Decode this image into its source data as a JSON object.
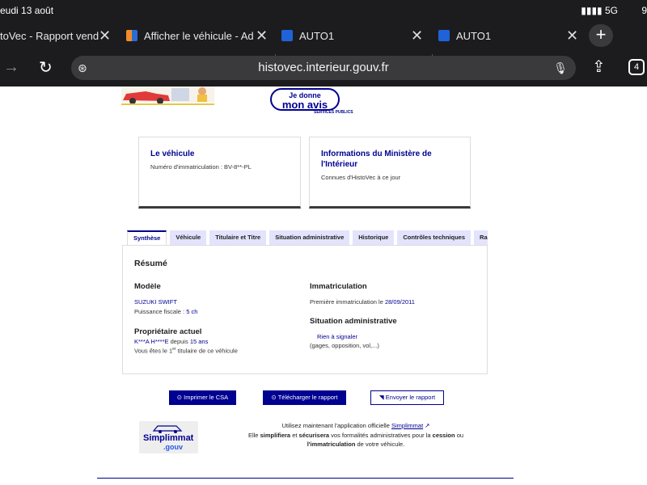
{
  "status_bar": {
    "time": "eudi 13 août",
    "signal": "5G",
    "battery": "9"
  },
  "browser_tabs": [
    {
      "title": "toVec - Rapport vend",
      "active": true
    },
    {
      "title": "Afficher le véhicule - Ad",
      "active": false
    },
    {
      "title": "AUTO1",
      "active": false
    },
    {
      "title": "AUTO1",
      "active": false
    }
  ],
  "toolbar": {
    "url": "histovec.interieur.gouv.fr",
    "tab_count": "4"
  },
  "banner": {
    "avis_line1": "Je donne",
    "avis_line2": "mon avis",
    "services_publics": "SERVICES PUBLICS"
  },
  "cards": {
    "vehicule": {
      "title": "Le véhicule",
      "text": "Numéro d'immatriculation : BV-8**-PL"
    },
    "ministere": {
      "title": "Informations du Ministère de l'Intérieur",
      "text": "Connues d'HistoVec à ce jour"
    }
  },
  "section_tabs": [
    "Synthèse",
    "Véhicule",
    "Titulaire et Titre",
    "Situation administrative",
    "Historique",
    "Contrôles techniques",
    "Rap"
  ],
  "resume": {
    "title": "Résumé",
    "modele_label": "Modèle",
    "modele": "SUZUKI SWIFT",
    "puissance_label": "Puissance fiscale :",
    "puissance": "5 ch",
    "proprietaire_label": "Propriétaire actuel",
    "proprietaire_name": "K***A H****E",
    "depuis_label": "depuis",
    "depuis": "15 ans",
    "titulaire_pre": "Vous êtes le 1",
    "titulaire_sup": "er",
    "titulaire_post": "titulaire de ce véhicule",
    "immat_label": "Immatriculation",
    "premiere_label": "Première immatriculation le",
    "premiere_date": "28/09/2011",
    "situation_label": "Situation administrative",
    "situation_value": "Rien à signaler",
    "situation_note": "(gages, opposition, vol,...)"
  },
  "actions": {
    "imprimer": "Imprimer le CSA",
    "telecharger": "Télécharger le rapport",
    "envoyer": "Envoyer le rapport"
  },
  "promo": {
    "logo_line1": "Simplimmat",
    "logo_line2": ".gouv",
    "line1": "Utilisez maintenant l'application officielle",
    "link": "Simplimmat",
    "line2_pre": "Elle",
    "line2_b1": "simplifiera",
    "line2_mid": "et",
    "line2_b2": "sécurisera",
    "line2_post": "vos formalités administratives pour la",
    "line2_b3": "cession",
    "line2_end": "ou",
    "line3_b": "l'immatriculation",
    "line3_post": "de votre véhicule."
  }
}
